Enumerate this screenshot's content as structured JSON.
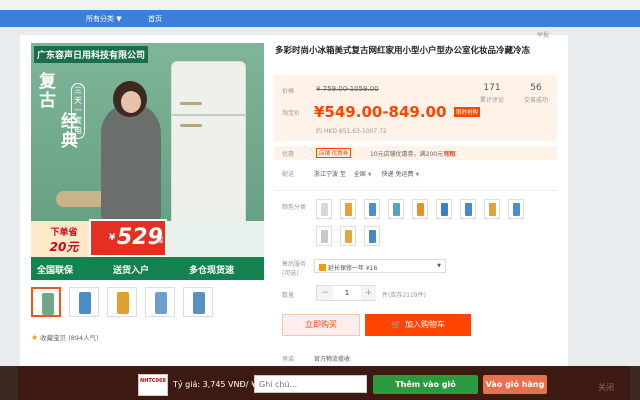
{
  "nav": {
    "all_categories": "所有分类 ▼",
    "home": "首页"
  },
  "report": "举报",
  "image": {
    "shop_name": "广东容声日用科技有限公司",
    "headline_a": "复古",
    "headline_b": "经典",
    "badge_a": "三天一度电",
    "badge_b": "三天一度电",
    "order_line1": "下单省",
    "order_line2": "20元",
    "promo_price": "529",
    "yen": "¥",
    "qi": "起",
    "bottom_1": "全国联保",
    "bottom_2": "送货入户",
    "bottom_3": "多仓现货速"
  },
  "favorite": "收藏宝贝 (894人气)",
  "product": {
    "title": "多彩时尚小冰箱美式复古网红家用小型小户型办公室化妆品冷藏冷冻"
  },
  "price": {
    "label_price": "价格",
    "original": "¥ 759.00-1059.00",
    "label_sale": "淘宝价",
    "sale": "¥549.00-849.00",
    "sale_tag": "限时抢购",
    "hkd": "约 HKD 651.63-1007.72",
    "reviews_count": "171",
    "reviews_label": "累计评论",
    "sales_count": "56",
    "sales_label": "交易成功"
  },
  "promo": {
    "label": "优惠",
    "coupon": "店铺 优惠券",
    "text": "10元店铺优惠券，满200元可用",
    "get": "领取"
  },
  "shipping": {
    "label": "配送",
    "from": "浙江宁波 至",
    "to": "全国",
    "method": "快递 免运费"
  },
  "color": {
    "label": "颜色分类"
  },
  "service": {
    "label": "售后服务",
    "sub": "(可选)",
    "option": "延长保修一年 ¥16"
  },
  "qty": {
    "label": "数量",
    "value": "1",
    "stock": "件(库存2119件)"
  },
  "buttons": {
    "buy": "立即购买",
    "cart": "加入购物车"
  },
  "cut_row": {
    "label": "承诺",
    "value": "官方物流揽收"
  },
  "ext": {
    "logo": "NHTC068",
    "rate": "Tỷ giá: 3,745 VNĐ/ ¥",
    "note_placeholder": "Ghi chú...",
    "add_btn": "Thêm vào giỏ",
    "view_btn": "Vào giỏ hàng",
    "close": "关闭"
  },
  "colors": {
    "thumb_bodies": [
      "#c85a4a",
      "#4a8bc8",
      "#e0a030",
      "#6aa0d0",
      "#5a90c0"
    ],
    "swatches": [
      "#d8d8d8",
      "#e8a030",
      "#4a90d0",
      "#5aa0c0",
      "#e89030",
      "#3a80c8",
      "#4a88c8",
      "#e0a040",
      "#4a90c8",
      "#c8c8c8",
      "#e0a840",
      "#4a88c0"
    ]
  }
}
